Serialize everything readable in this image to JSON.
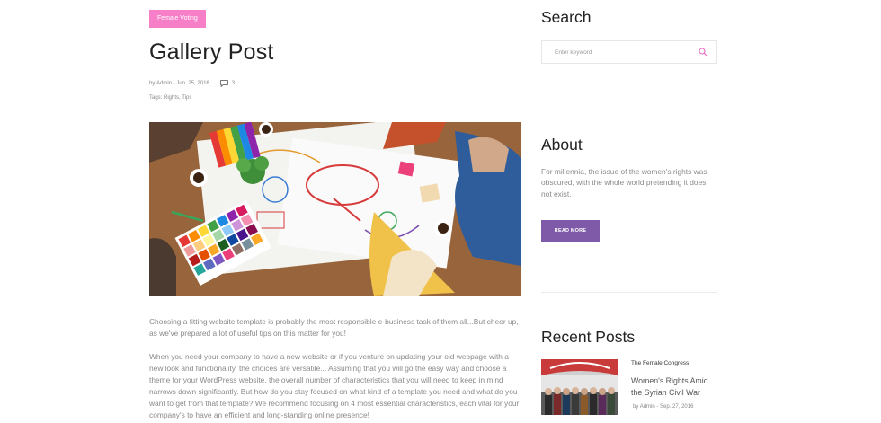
{
  "post": {
    "category": "Female Voting",
    "title": "Gallery Post",
    "meta": {
      "by_label": "by",
      "author": "Admin",
      "separator": "-",
      "date": "Jun. 25, 2016",
      "comments_count": "3",
      "comment_icon": "speech-bubble-icon"
    },
    "tags": {
      "label": "Tags:",
      "items": [
        "Rights",
        "Tips"
      ]
    },
    "image_alt": "Team working around a table with charts and color swatches",
    "paragraphs": [
      "Choosing a fitting website template is probably the most responsible e-business task of them all...But cheer up, as we've prepared a lot of useful tips on this matter for you!",
      "When you need your company to have a new website or if you venture on updating your old webpage with a new look and functionality, the choices are versatile... Assuming that you will go the easy way and choose a theme for your WordPress website, the overall number of characteristics that you will need to keep in mind narrows down significantly. But how do you stay focused on what kind of a template you need and what do you want to get from that template? We recommend focusing on 4 most essential characteristics, each vital for your company's to have an efficient and long-standing online presence!"
    ]
  },
  "sidebar": {
    "search": {
      "title": "Search",
      "placeholder": "Enter keyword",
      "icon": "magnifier-icon"
    },
    "about": {
      "title": "About",
      "text": "For millennia, the issue of the women's rights was obscured, with the whole world pretending it does not exist.",
      "button_label": "READ MORE"
    },
    "recent_posts": {
      "title": "Recent Posts",
      "items": [
        {
          "category": "The Female Congress",
          "title": "Women's Rights Amid the Syrian Civil War",
          "by_label": "by",
          "author": "Admin",
          "separator": "-",
          "date": "Sep. 27, 2016"
        }
      ]
    }
  },
  "colors": {
    "badge_pink": "#f77fc7",
    "button_purple": "#7e5aa8",
    "search_icon_pink": "#e86bc4",
    "heading": "#222222",
    "body_text": "#8a8a8a"
  }
}
